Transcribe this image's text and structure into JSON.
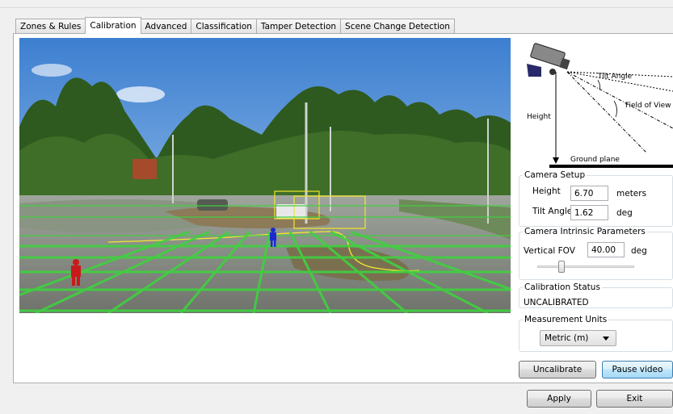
{
  "tabs": [
    {
      "label": "Zones & Rules",
      "active": false
    },
    {
      "label": "Calibration",
      "active": true
    },
    {
      "label": "Advanced",
      "active": false
    },
    {
      "label": "Classification",
      "active": false
    },
    {
      "label": "Tamper Detection",
      "active": false
    },
    {
      "label": "Scene Change Detection",
      "active": false
    }
  ],
  "diagram": {
    "tilt_angle_label": "Tilt Angle",
    "field_of_view_label": "Field of View",
    "height_label": "Height",
    "ground_plane_label": "Ground plane"
  },
  "camera_setup": {
    "title": "Camera Setup",
    "height_label": "Height",
    "height_value": "6.70",
    "height_unit": "meters",
    "tilt_label": "Tilt Angle",
    "tilt_value": "1.62",
    "tilt_unit": "deg"
  },
  "intrinsic": {
    "title": "Camera Intrinsic Parameters",
    "fov_label": "Vertical FOV",
    "fov_value": "40.00",
    "fov_unit": "deg"
  },
  "calibration_status": {
    "title": "Calibration Status",
    "value": "UNCALIBRATED"
  },
  "measurement_units": {
    "title": "Measurement Units",
    "selected": "Metric (m)"
  },
  "buttons": {
    "uncalibrate": "Uncalibrate",
    "pause_video": "Pause video",
    "apply": "Apply",
    "exit": "Exit"
  },
  "colors": {
    "grid": "#3fd23f",
    "track": "#f0e830",
    "tab_border": "#adadad",
    "focus_border": "#3c7fb1"
  }
}
